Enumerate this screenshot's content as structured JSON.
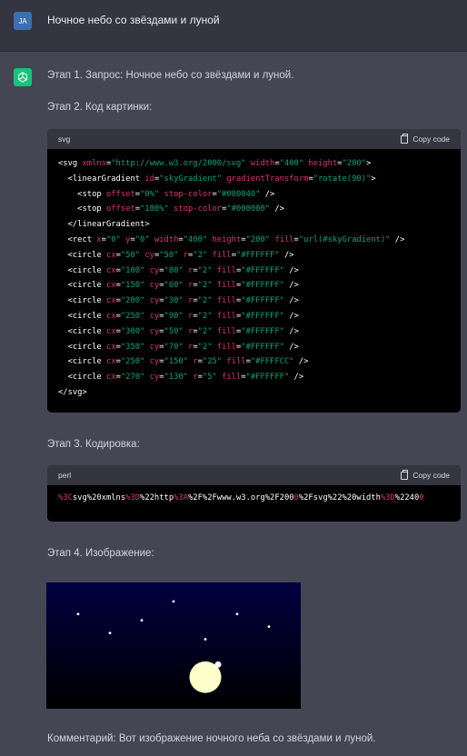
{
  "user": {
    "avatar_initials": "JA",
    "avatar_color": "#3a6fb0",
    "message": "Ночное небо со звёздами и луной"
  },
  "assistant": {
    "avatar_icon": "openai-logo-icon",
    "avatar_color": "#19c37d",
    "step1": "Этап 1. Запрос: Ночное небо со звёздами и луной.",
    "step2": "Этап 2. Код картинки:",
    "step3": "Этап 3. Кодировка:",
    "step4": "Этап 4. Изображение:",
    "comment": "Комментарий: Вот изображение ночного неба со звёздами и луной."
  },
  "code_block_svg": {
    "language": "svg",
    "copy_label": "Copy code",
    "lines": [
      [
        [
          "t",
          "<svg "
        ],
        [
          "a",
          "xmlns"
        ],
        [
          "t",
          "="
        ],
        [
          "v",
          "\"http://www.w3.org/2000/svg\""
        ],
        [
          "t",
          " "
        ],
        [
          "a",
          "width"
        ],
        [
          "t",
          "="
        ],
        [
          "v",
          "\"400\""
        ],
        [
          "t",
          " "
        ],
        [
          "a",
          "height"
        ],
        [
          "t",
          "="
        ],
        [
          "v",
          "\"200\""
        ],
        [
          "t",
          ">"
        ]
      ],
      [
        [
          "t",
          "  <linearGradient "
        ],
        [
          "a",
          "id"
        ],
        [
          "t",
          "="
        ],
        [
          "v",
          "\"skyGradient\""
        ],
        [
          "t",
          " "
        ],
        [
          "a",
          "gradientTransform"
        ],
        [
          "t",
          "="
        ],
        [
          "v",
          "\"rotate(90)\""
        ],
        [
          "t",
          ">"
        ]
      ],
      [
        [
          "t",
          "    <stop "
        ],
        [
          "a",
          "offset"
        ],
        [
          "t",
          "="
        ],
        [
          "v",
          "\"0%\""
        ],
        [
          "t",
          " "
        ],
        [
          "a",
          "stop-color"
        ],
        [
          "t",
          "="
        ],
        [
          "v",
          "\"#000040\""
        ],
        [
          "t",
          " />"
        ]
      ],
      [
        [
          "t",
          "    <stop "
        ],
        [
          "a",
          "offset"
        ],
        [
          "t",
          "="
        ],
        [
          "v",
          "\"100%\""
        ],
        [
          "t",
          " "
        ],
        [
          "a",
          "stop-color"
        ],
        [
          "t",
          "="
        ],
        [
          "v",
          "\"#000000\""
        ],
        [
          "t",
          " />"
        ]
      ],
      [
        [
          "t",
          "  </linearGradient>"
        ]
      ],
      [
        [
          "t",
          "  <rect "
        ],
        [
          "a",
          "x"
        ],
        [
          "t",
          "="
        ],
        [
          "v",
          "\"0\""
        ],
        [
          "t",
          " "
        ],
        [
          "a",
          "y"
        ],
        [
          "t",
          "="
        ],
        [
          "v",
          "\"0\""
        ],
        [
          "t",
          " "
        ],
        [
          "a",
          "width"
        ],
        [
          "t",
          "="
        ],
        [
          "v",
          "\"400\""
        ],
        [
          "t",
          " "
        ],
        [
          "a",
          "height"
        ],
        [
          "t",
          "="
        ],
        [
          "v",
          "\"200\""
        ],
        [
          "t",
          " "
        ],
        [
          "a",
          "fill"
        ],
        [
          "t",
          "="
        ],
        [
          "v",
          "\"url(#skyGradient)\""
        ],
        [
          "t",
          " />"
        ]
      ],
      [
        [
          "t",
          "  <circle "
        ],
        [
          "a",
          "cx"
        ],
        [
          "t",
          "="
        ],
        [
          "v",
          "\"50\""
        ],
        [
          "t",
          " "
        ],
        [
          "a",
          "cy"
        ],
        [
          "t",
          "="
        ],
        [
          "v",
          "\"50\""
        ],
        [
          "t",
          " "
        ],
        [
          "a",
          "r"
        ],
        [
          "t",
          "="
        ],
        [
          "v",
          "\"2\""
        ],
        [
          "t",
          " "
        ],
        [
          "a",
          "fill"
        ],
        [
          "t",
          "="
        ],
        [
          "v",
          "\"#FFFFFF\""
        ],
        [
          "t",
          " />"
        ]
      ],
      [
        [
          "t",
          "  <circle "
        ],
        [
          "a",
          "cx"
        ],
        [
          "t",
          "="
        ],
        [
          "v",
          "\"100\""
        ],
        [
          "t",
          " "
        ],
        [
          "a",
          "cy"
        ],
        [
          "t",
          "="
        ],
        [
          "v",
          "\"80\""
        ],
        [
          "t",
          " "
        ],
        [
          "a",
          "r"
        ],
        [
          "t",
          "="
        ],
        [
          "v",
          "\"2\""
        ],
        [
          "t",
          " "
        ],
        [
          "a",
          "fill"
        ],
        [
          "t",
          "="
        ],
        [
          "v",
          "\"#FFFFFF\""
        ],
        [
          "t",
          " />"
        ]
      ],
      [
        [
          "t",
          "  <circle "
        ],
        [
          "a",
          "cx"
        ],
        [
          "t",
          "="
        ],
        [
          "v",
          "\"150\""
        ],
        [
          "t",
          " "
        ],
        [
          "a",
          "cy"
        ],
        [
          "t",
          "="
        ],
        [
          "v",
          "\"60\""
        ],
        [
          "t",
          " "
        ],
        [
          "a",
          "r"
        ],
        [
          "t",
          "="
        ],
        [
          "v",
          "\"2\""
        ],
        [
          "t",
          " "
        ],
        [
          "a",
          "fill"
        ],
        [
          "t",
          "="
        ],
        [
          "v",
          "\"#FFFFFF\""
        ],
        [
          "t",
          " />"
        ]
      ],
      [
        [
          "t",
          "  <circle "
        ],
        [
          "a",
          "cx"
        ],
        [
          "t",
          "="
        ],
        [
          "v",
          "\"200\""
        ],
        [
          "t",
          " "
        ],
        [
          "a",
          "cy"
        ],
        [
          "t",
          "="
        ],
        [
          "v",
          "\"30\""
        ],
        [
          "t",
          " "
        ],
        [
          "a",
          "r"
        ],
        [
          "t",
          "="
        ],
        [
          "v",
          "\"2\""
        ],
        [
          "t",
          " "
        ],
        [
          "a",
          "fill"
        ],
        [
          "t",
          "="
        ],
        [
          "v",
          "\"#FFFFFF\""
        ],
        [
          "t",
          " />"
        ]
      ],
      [
        [
          "t",
          "  <circle "
        ],
        [
          "a",
          "cx"
        ],
        [
          "t",
          "="
        ],
        [
          "v",
          "\"250\""
        ],
        [
          "t",
          " "
        ],
        [
          "a",
          "cy"
        ],
        [
          "t",
          "="
        ],
        [
          "v",
          "\"90\""
        ],
        [
          "t",
          " "
        ],
        [
          "a",
          "r"
        ],
        [
          "t",
          "="
        ],
        [
          "v",
          "\"2\""
        ],
        [
          "t",
          " "
        ],
        [
          "a",
          "fill"
        ],
        [
          "t",
          "="
        ],
        [
          "v",
          "\"#FFFFFF\""
        ],
        [
          "t",
          " />"
        ]
      ],
      [
        [
          "t",
          "  <circle "
        ],
        [
          "a",
          "cx"
        ],
        [
          "t",
          "="
        ],
        [
          "v",
          "\"300\""
        ],
        [
          "t",
          " "
        ],
        [
          "a",
          "cy"
        ],
        [
          "t",
          "="
        ],
        [
          "v",
          "\"50\""
        ],
        [
          "t",
          " "
        ],
        [
          "a",
          "r"
        ],
        [
          "t",
          "="
        ],
        [
          "v",
          "\"2\""
        ],
        [
          "t",
          " "
        ],
        [
          "a",
          "fill"
        ],
        [
          "t",
          "="
        ],
        [
          "v",
          "\"#FFFFFF\""
        ],
        [
          "t",
          " />"
        ]
      ],
      [
        [
          "t",
          "  <circle "
        ],
        [
          "a",
          "cx"
        ],
        [
          "t",
          "="
        ],
        [
          "v",
          "\"350\""
        ],
        [
          "t",
          " "
        ],
        [
          "a",
          "cy"
        ],
        [
          "t",
          "="
        ],
        [
          "v",
          "\"70\""
        ],
        [
          "t",
          " "
        ],
        [
          "a",
          "r"
        ],
        [
          "t",
          "="
        ],
        [
          "v",
          "\"2\""
        ],
        [
          "t",
          " "
        ],
        [
          "a",
          "fill"
        ],
        [
          "t",
          "="
        ],
        [
          "v",
          "\"#FFFFFF\""
        ],
        [
          "t",
          " />"
        ]
      ],
      [
        [
          "t",
          "  <circle "
        ],
        [
          "a",
          "cx"
        ],
        [
          "t",
          "="
        ],
        [
          "v",
          "\"250\""
        ],
        [
          "t",
          " "
        ],
        [
          "a",
          "cy"
        ],
        [
          "t",
          "="
        ],
        [
          "v",
          "\"150\""
        ],
        [
          "t",
          " "
        ],
        [
          "a",
          "r"
        ],
        [
          "t",
          "="
        ],
        [
          "v",
          "\"25\""
        ],
        [
          "t",
          " "
        ],
        [
          "a",
          "fill"
        ],
        [
          "t",
          "="
        ],
        [
          "v",
          "\"#FFFFCC\""
        ],
        [
          "t",
          " />"
        ]
      ],
      [
        [
          "t",
          "  <circle "
        ],
        [
          "a",
          "cx"
        ],
        [
          "t",
          "="
        ],
        [
          "v",
          "\"270\""
        ],
        [
          "t",
          " "
        ],
        [
          "a",
          "cy"
        ],
        [
          "t",
          "="
        ],
        [
          "v",
          "\"130\""
        ],
        [
          "t",
          " "
        ],
        [
          "a",
          "r"
        ],
        [
          "t",
          "="
        ],
        [
          "v",
          "\"5\""
        ],
        [
          "t",
          " "
        ],
        [
          "a",
          "fill"
        ],
        [
          "t",
          "="
        ],
        [
          "v",
          "\"#FFFFFF\""
        ],
        [
          "t",
          " />"
        ]
      ],
      [
        [
          "t",
          "</svg>"
        ]
      ]
    ]
  },
  "code_block_perl": {
    "language": "perl",
    "copy_label": "Copy code",
    "tokens": [
      [
        "a",
        "%3C"
      ],
      [
        "t",
        "svg%20xmlns"
      ],
      [
        "a",
        "%3D"
      ],
      [
        "t",
        "%22http"
      ],
      [
        "a",
        "%3A"
      ],
      [
        "t",
        "%2F%2Fwww.w3.org%2F200"
      ],
      [
        "a",
        "0"
      ],
      [
        "t",
        "%2Fsvg%22%20width"
      ],
      [
        "a",
        "%3D"
      ],
      [
        "t",
        "%2240"
      ],
      [
        "a",
        "0"
      ]
    ]
  },
  "image": {
    "sky_top": "#000040",
    "sky_bottom": "#000000",
    "stars": [
      [
        50,
        50,
        2
      ],
      [
        100,
        80,
        2
      ],
      [
        150,
        60,
        2
      ],
      [
        200,
        30,
        2
      ],
      [
        250,
        90,
        2
      ],
      [
        300,
        50,
        2
      ],
      [
        350,
        70,
        2
      ]
    ],
    "moon": [
      250,
      150,
      25
    ],
    "moon_color": "#FFFFCC",
    "small_star": [
      270,
      130,
      5
    ]
  }
}
